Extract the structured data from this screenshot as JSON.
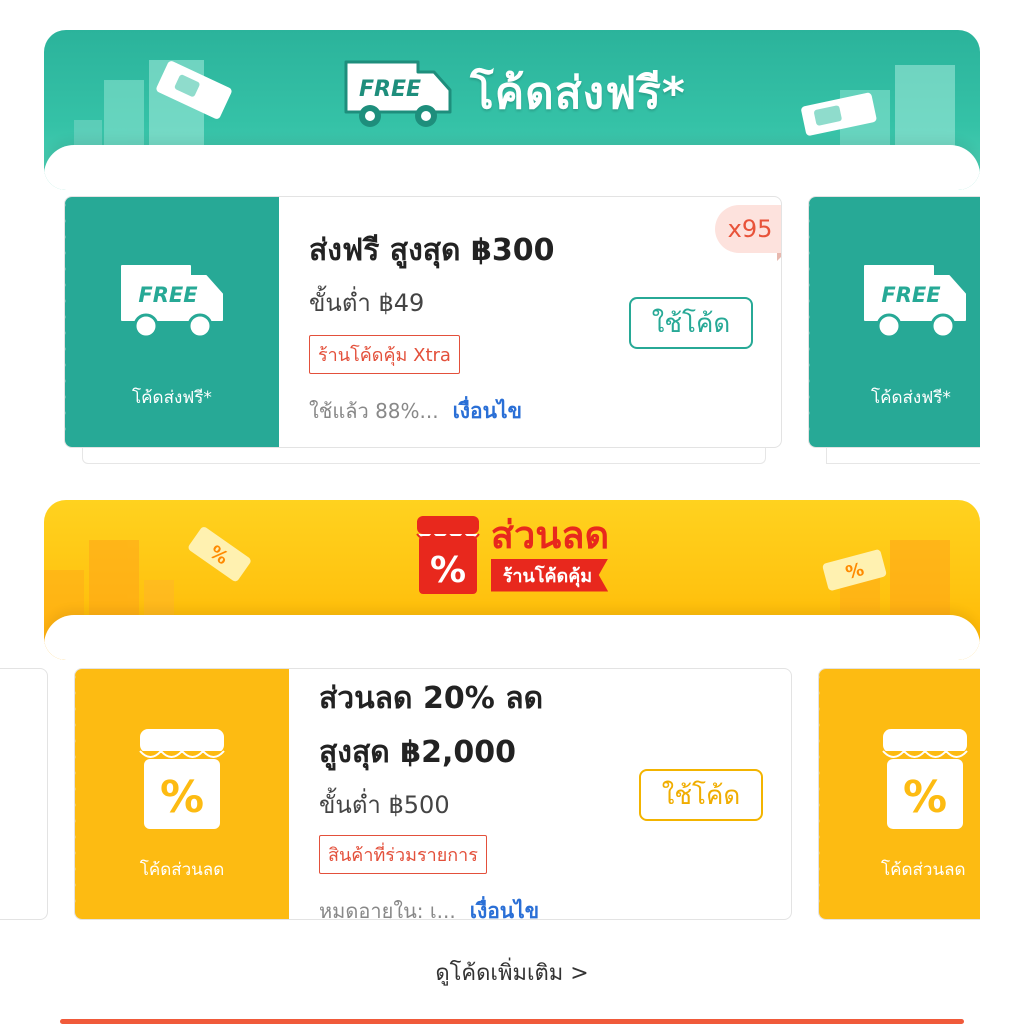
{
  "free_section": {
    "title": "โค้ดส่งฟรี*",
    "badge_text": "FREE",
    "coupon": {
      "stub_badge": "FREE",
      "stub_label": "โค้ดส่งฟรี*",
      "title": "ส่งฟรี สูงสุด ฿300",
      "min_spend": "ขั้นต่ำ ฿49",
      "tag": "ร้านโค้ดคุ้ม Xtra",
      "usage": "ใช้แล้ว 88%...",
      "conditions": "เงื่อนไข",
      "use_button": "ใช้โค้ด",
      "quantity": "x95"
    },
    "next_coupon": {
      "stub_badge": "FREE",
      "stub_label": "โค้ดส่งฟรี*"
    }
  },
  "discount_section": {
    "title": "ส่วนลด",
    "subtitle": "ร้านโค้ดคุ้ม",
    "coupon": {
      "stub_label": "โค้ดส่วนลด",
      "title_line1": "ส่วนลด 20% ลด",
      "title_line2": "สูงสุด ฿2,000",
      "min_spend": "ขั้นต่ำ ฿500",
      "tag": "สินค้าที่ร่วมรายการ",
      "expiry": "หมดอายุใน: เ...",
      "conditions": "เงื่อนไข",
      "use_button": "ใช้โค้ด"
    },
    "next_coupon": {
      "stub_label": "โค้ดส่วนลด"
    }
  },
  "more_link": "ดูโค้ดเพิ่มเติม >",
  "colors": {
    "teal": "#27a996",
    "gold": "#fdbb12",
    "red": "#e8281d",
    "link_blue": "#2a6fd6"
  }
}
